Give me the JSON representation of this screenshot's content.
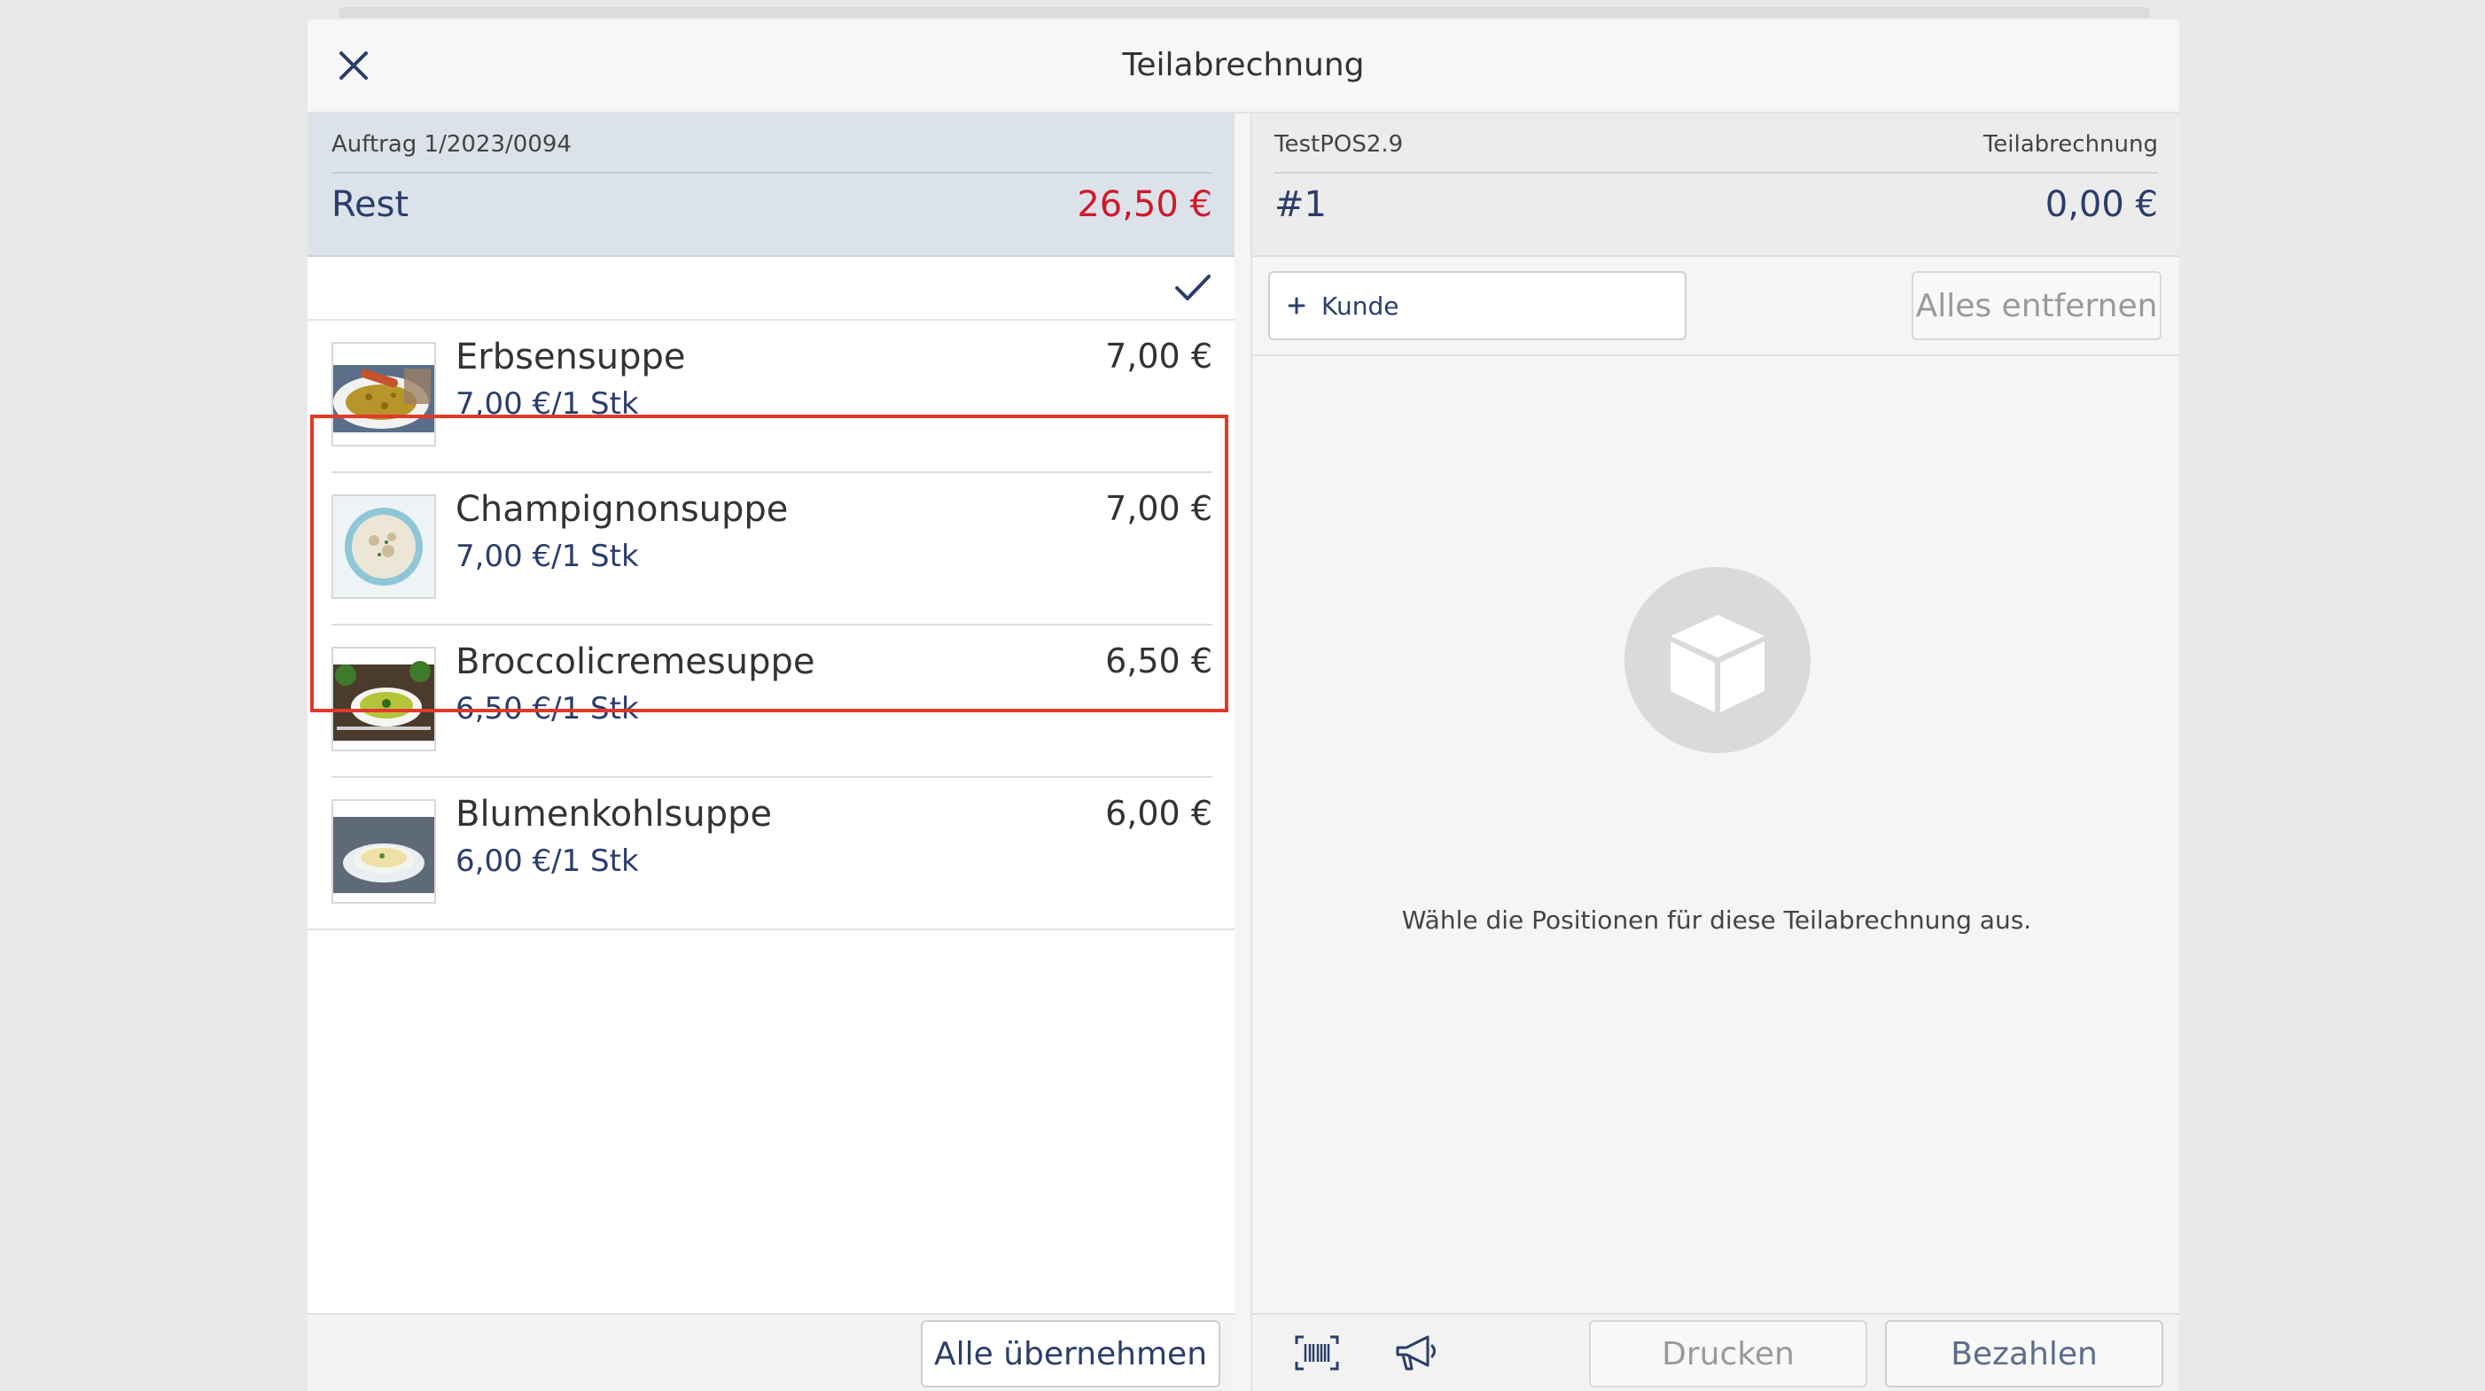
{
  "dialog": {
    "title": "Teilabrechnung"
  },
  "left": {
    "order_number": "Auftrag 1/2023/0094",
    "rest_label": "Rest",
    "rest_value": "26,50 €",
    "items": [
      {
        "name": "Erbsensuppe",
        "unit": "7,00 €/1 Stk",
        "price": "7,00 €",
        "selected": true
      },
      {
        "name": "Champignonsuppe",
        "unit": "7,00 €/1 Stk",
        "price": "7,00 €",
        "selected": true
      },
      {
        "name": "Broccolicremesuppe",
        "unit": "6,50 €/1 Stk",
        "price": "6,50 €",
        "selected": false
      },
      {
        "name": "Blumenkohlsuppe",
        "unit": "6,00 €/1 Stk",
        "price": "6,00 €",
        "selected": false
      }
    ],
    "take_all_label": "Alle übernehmen"
  },
  "right": {
    "pos_name": "TestPOS2.9",
    "section_label": "Teilabrechnung",
    "bill_number": "#1",
    "bill_total": "0,00 €",
    "customer_button": "Kunde",
    "remove_all_label": "Alles entfernen",
    "empty_message": "Wähle die Positionen für diese Teilabrechnung aus.",
    "print_label": "Drucken",
    "pay_label": "Bezahlen"
  },
  "colors": {
    "accent": "#2b3d6b",
    "rest_red": "#d0192a",
    "highlight": "#e03a28"
  },
  "icons": [
    "close-icon",
    "check-icon",
    "plus-icon",
    "box-icon",
    "barcode-icon",
    "megaphone-icon"
  ]
}
